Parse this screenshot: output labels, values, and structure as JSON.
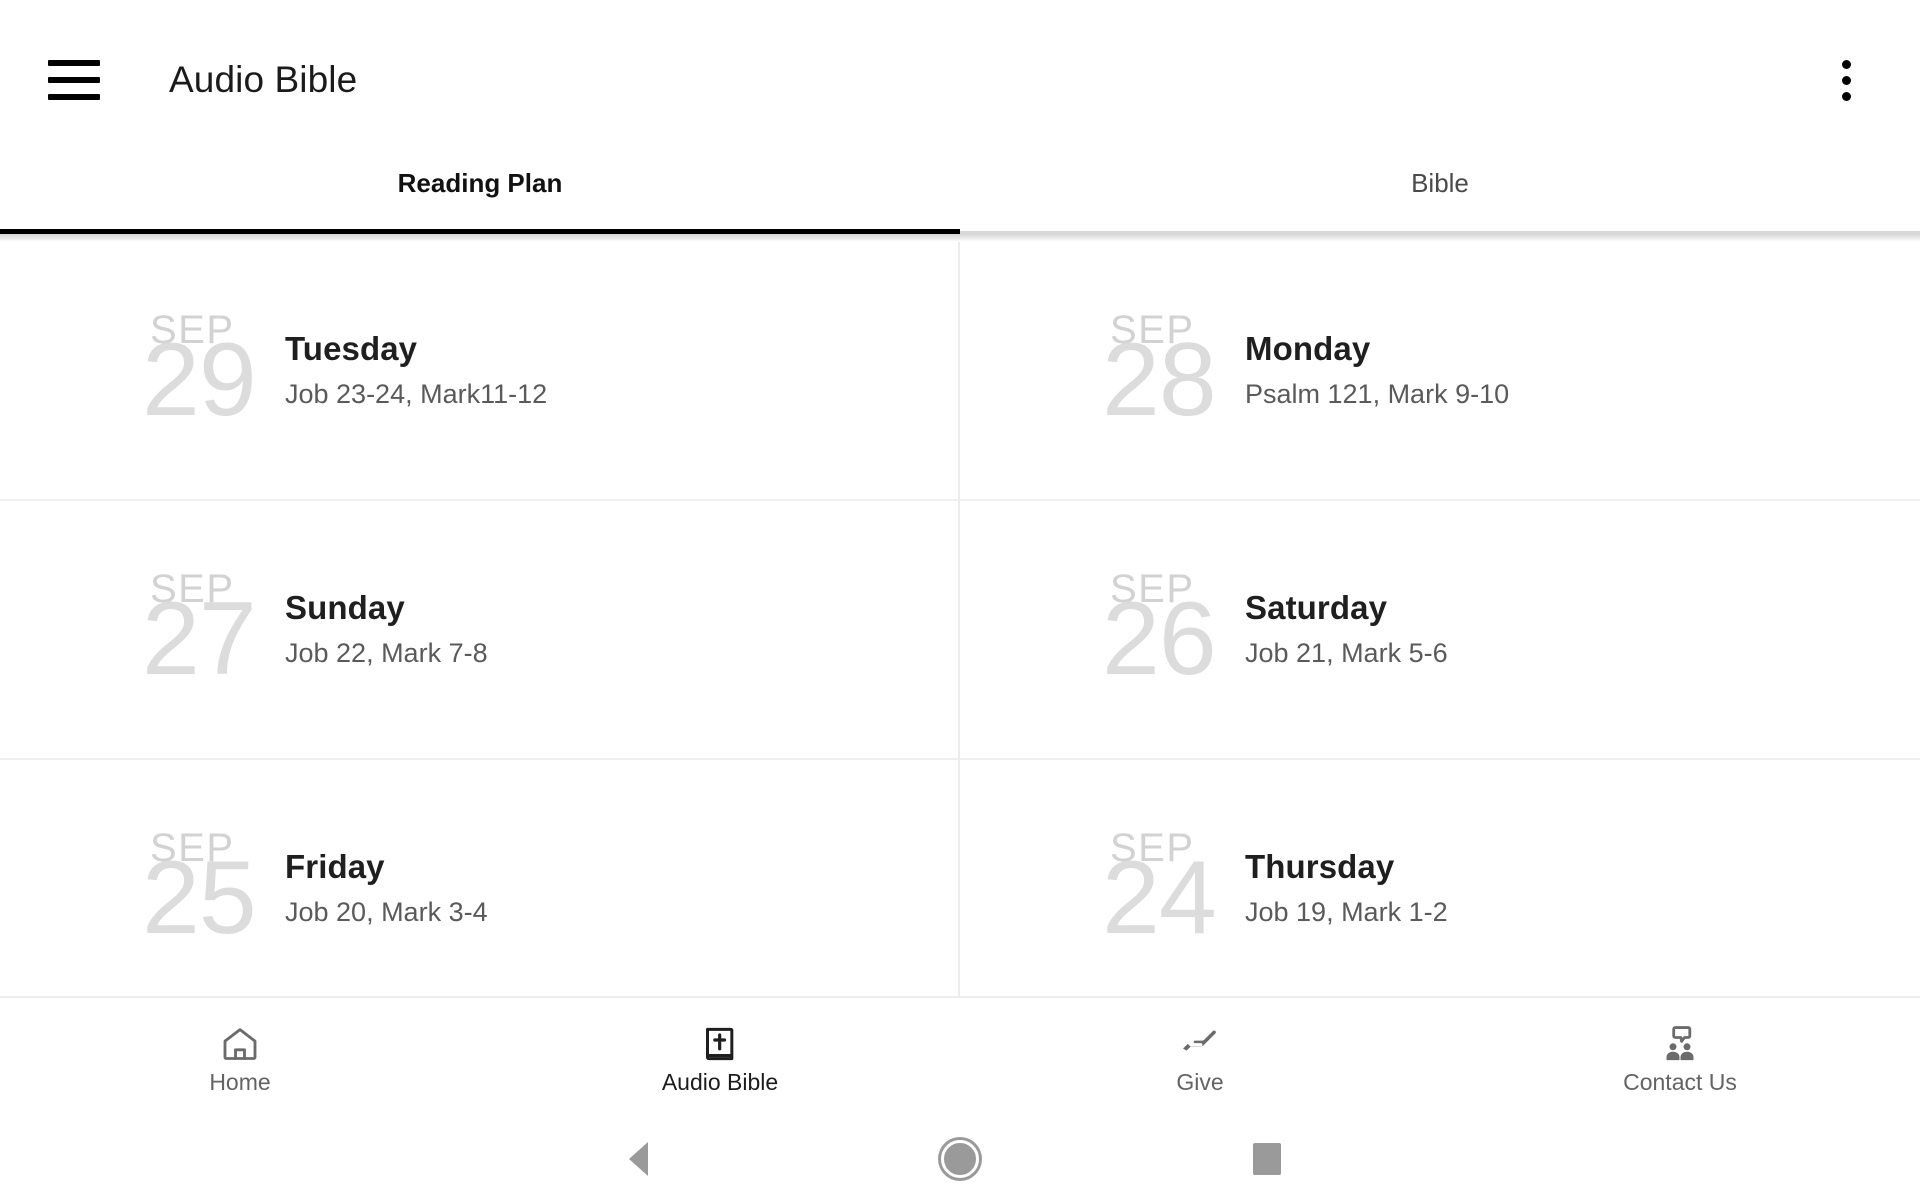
{
  "app": {
    "title": "Audio Bible",
    "menu_icon": "hamburger-menu-icon",
    "overflow_icon": "more-vertical-icon"
  },
  "tabs": [
    {
      "label": "Reading Plan",
      "active": true
    },
    {
      "label": "Bible",
      "active": false
    }
  ],
  "reading_plan": {
    "entries": [
      {
        "month": "SEP",
        "day": "29",
        "weekday": "Tuesday",
        "passage": "Job 23-24, Mark11-12"
      },
      {
        "month": "SEP",
        "day": "28",
        "weekday": "Monday",
        "passage": "Psalm 121, Mark 9-10"
      },
      {
        "month": "SEP",
        "day": "27",
        "weekday": "Sunday",
        "passage": "Job 22, Mark 7-8"
      },
      {
        "month": "SEP",
        "day": "26",
        "weekday": "Saturday",
        "passage": "Job 21, Mark 5-6"
      },
      {
        "month": "SEP",
        "day": "25",
        "weekday": "Friday",
        "passage": "Job 20, Mark 3-4"
      },
      {
        "month": "SEP",
        "day": "24",
        "weekday": "Thursday",
        "passage": "Job 19, Mark 1-2"
      }
    ]
  },
  "bottom_nav": {
    "items": [
      {
        "label": "Home",
        "icon": "home-icon",
        "active": false
      },
      {
        "label": "Audio Bible",
        "icon": "bible-book-icon",
        "active": true
      },
      {
        "label": "Give",
        "icon": "open-hand-icon",
        "active": false
      },
      {
        "label": "Contact Us",
        "icon": "contact-people-icon",
        "active": false
      }
    ]
  },
  "system_nav": {
    "back": "back-triangle-icon",
    "home": "home-circle-icon",
    "recents": "recents-square-icon"
  },
  "colors": {
    "accent": "#000000",
    "date_gray": "#dcdcdc",
    "muted_text": "#5a5a5a",
    "nav_gray": "#9a9a9a"
  }
}
